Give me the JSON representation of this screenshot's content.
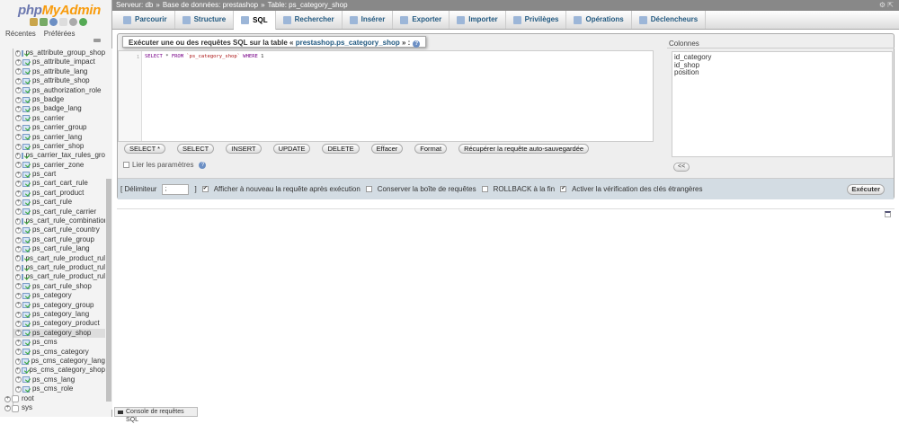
{
  "logo": {
    "php": "php",
    "myadmin": "MyAdmin"
  },
  "sidebar": {
    "nav_links": [
      "Récentes",
      "Préférées"
    ],
    "tables": [
      "ps_attribute_group_shop",
      "ps_attribute_impact",
      "ps_attribute_lang",
      "ps_attribute_shop",
      "ps_authorization_role",
      "ps_badge",
      "ps_badge_lang",
      "ps_carrier",
      "ps_carrier_group",
      "ps_carrier_lang",
      "ps_carrier_shop",
      "ps_carrier_tax_rules_group",
      "ps_carrier_zone",
      "ps_cart",
      "ps_cart_cart_rule",
      "ps_cart_product",
      "ps_cart_rule",
      "ps_cart_rule_carrier",
      "ps_cart_rule_combination",
      "ps_cart_rule_country",
      "ps_cart_rule_group",
      "ps_cart_rule_lang",
      "ps_cart_rule_product_rule",
      "ps_cart_rule_product_rule_",
      "ps_cart_rule_product_rule_",
      "ps_cart_rule_shop",
      "ps_category",
      "ps_category_group",
      "ps_category_lang",
      "ps_category_product",
      "ps_category_shop",
      "ps_cms",
      "ps_cms_category",
      "ps_cms_category_lang",
      "ps_cms_category_shop",
      "ps_cms_lang",
      "ps_cms_role"
    ],
    "selected": "ps_category_shop",
    "databases": [
      "root",
      "sys"
    ]
  },
  "breadcrumb": {
    "server": "Serveur: db",
    "sep": "»",
    "database": "Base de données: prestashop",
    "table": "Table: ps_category_shop"
  },
  "tabs": [
    "Parcourir",
    "Structure",
    "SQL",
    "Rechercher",
    "Insérer",
    "Exporter",
    "Importer",
    "Privilèges",
    "Opérations",
    "Déclencheurs"
  ],
  "active_tab": "SQL",
  "query": {
    "legend_prefix": "Exécuter une ou des requêtes SQL sur la table «",
    "legend_table": "prestashop.ps_category_shop",
    "legend_suffix": "» :",
    "line_number": "1",
    "code": {
      "select": "SELECT",
      "star": "*",
      "from": "FROM",
      "table": "`ps_category_shop`",
      "where": "WHERE",
      "value": "1"
    },
    "buttons": [
      "SELECT *",
      "SELECT",
      "INSERT",
      "UPDATE",
      "DELETE",
      "Effacer",
      "Format",
      "Récupérer la requête auto-sauvegardée"
    ],
    "bind_params": "Lier les paramètres",
    "columns_title": "Colonnes",
    "columns": [
      "id_category",
      "id_shop",
      "position"
    ],
    "insert_column_button": "<<"
  },
  "options": {
    "delimiter_label": "[ Délimiteur",
    "delimiter_value": ";",
    "delimiter_close": "]",
    "show_query": {
      "label": "Afficher à nouveau la requête après exécution",
      "checked": true
    },
    "keep_box": {
      "label": "Conserver la boîte de requêtes",
      "checked": false
    },
    "rollback": {
      "label": "ROLLBACK à la fin",
      "checked": false
    },
    "fk_check": {
      "label": "Activer la vérification des clés étrangères",
      "checked": true
    },
    "execute": "Exécuter"
  },
  "console": "Console de requêtes SQL"
}
